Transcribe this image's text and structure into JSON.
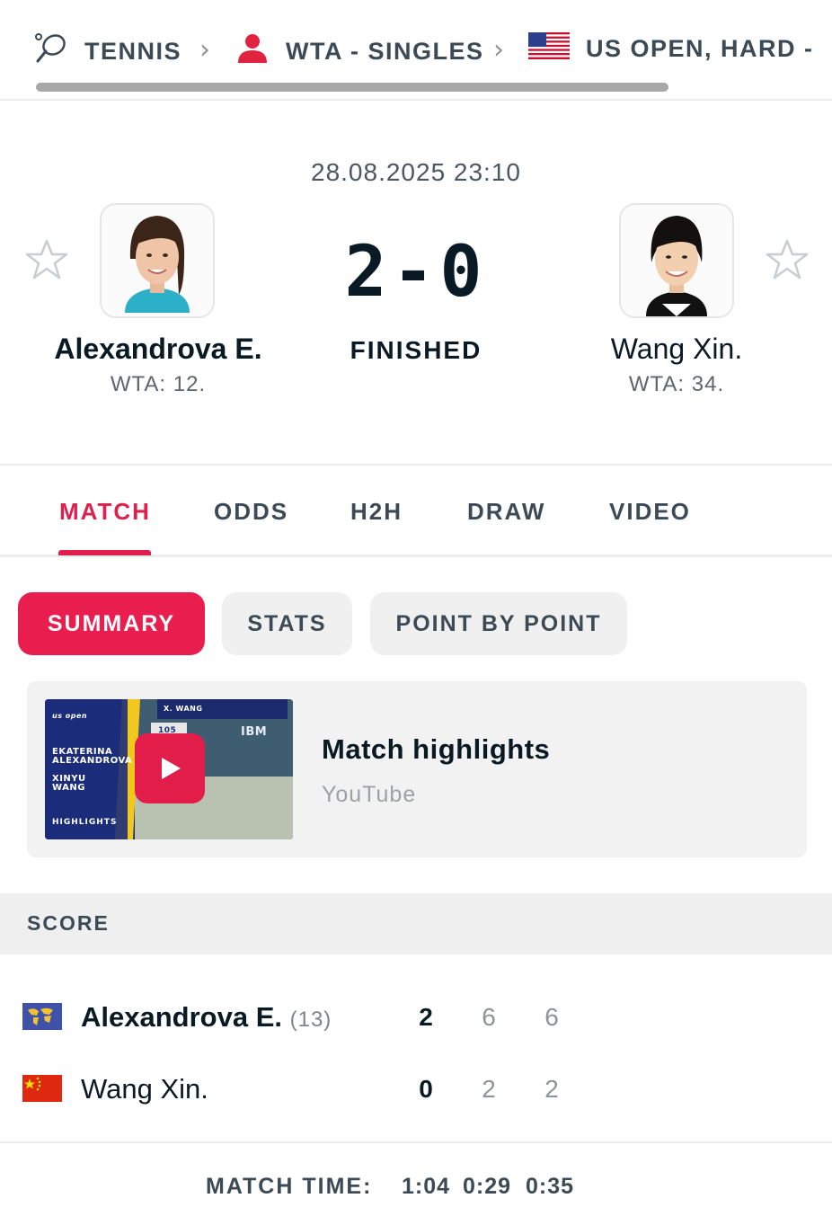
{
  "breadcrumb": {
    "sport": "TENNIS",
    "category": "WTA - SINGLES",
    "tournament": "US OPEN, HARD -"
  },
  "match": {
    "datetime": "28.08.2025 23:10",
    "score_home": "2",
    "score_sep": "-",
    "score_away": "0",
    "status": "FINISHED",
    "home": {
      "name": "Alexandrova E.",
      "rank": "WTA: 12."
    },
    "away": {
      "name": "Wang Xin.",
      "rank": "WTA: 34."
    }
  },
  "tabs": [
    {
      "label": "MATCH",
      "active": true
    },
    {
      "label": "ODDS"
    },
    {
      "label": "H2H"
    },
    {
      "label": "DRAW"
    },
    {
      "label": "VIDEO"
    }
  ],
  "subtabs": [
    {
      "label": "SUMMARY",
      "active": true
    },
    {
      "label": "STATS"
    },
    {
      "label": "POINT BY POINT"
    }
  ],
  "highlights": {
    "title": "Match highlights",
    "source": "YouTube",
    "thumb_text": {
      "brand": "us open",
      "player1_first": "EKATERINA",
      "player1_last": "ALEXANDROVA",
      "player2_first": "XINYU",
      "player2_last": "WANG",
      "tag": "HIGHLIGHTS",
      "scoreboard_name": "X. WANG",
      "scoreboard_speed": "105",
      "sponsor": "IBM"
    }
  },
  "score": {
    "header": "SCORE",
    "rows": [
      {
        "name": "Alexandrova E.",
        "seed": "(13)",
        "total": "2",
        "sets": [
          "6",
          "6"
        ]
      },
      {
        "name": "Wang Xin.",
        "seed": "",
        "total": "0",
        "sets": [
          "2",
          "2"
        ]
      }
    ],
    "match_time_label": "MATCH TIME:",
    "match_time": [
      "1:04",
      "0:29",
      "0:35"
    ]
  },
  "colors": {
    "accent": "#df1f4d",
    "text_dark": "#0a1a24",
    "text_muted": "#3b4a54"
  }
}
